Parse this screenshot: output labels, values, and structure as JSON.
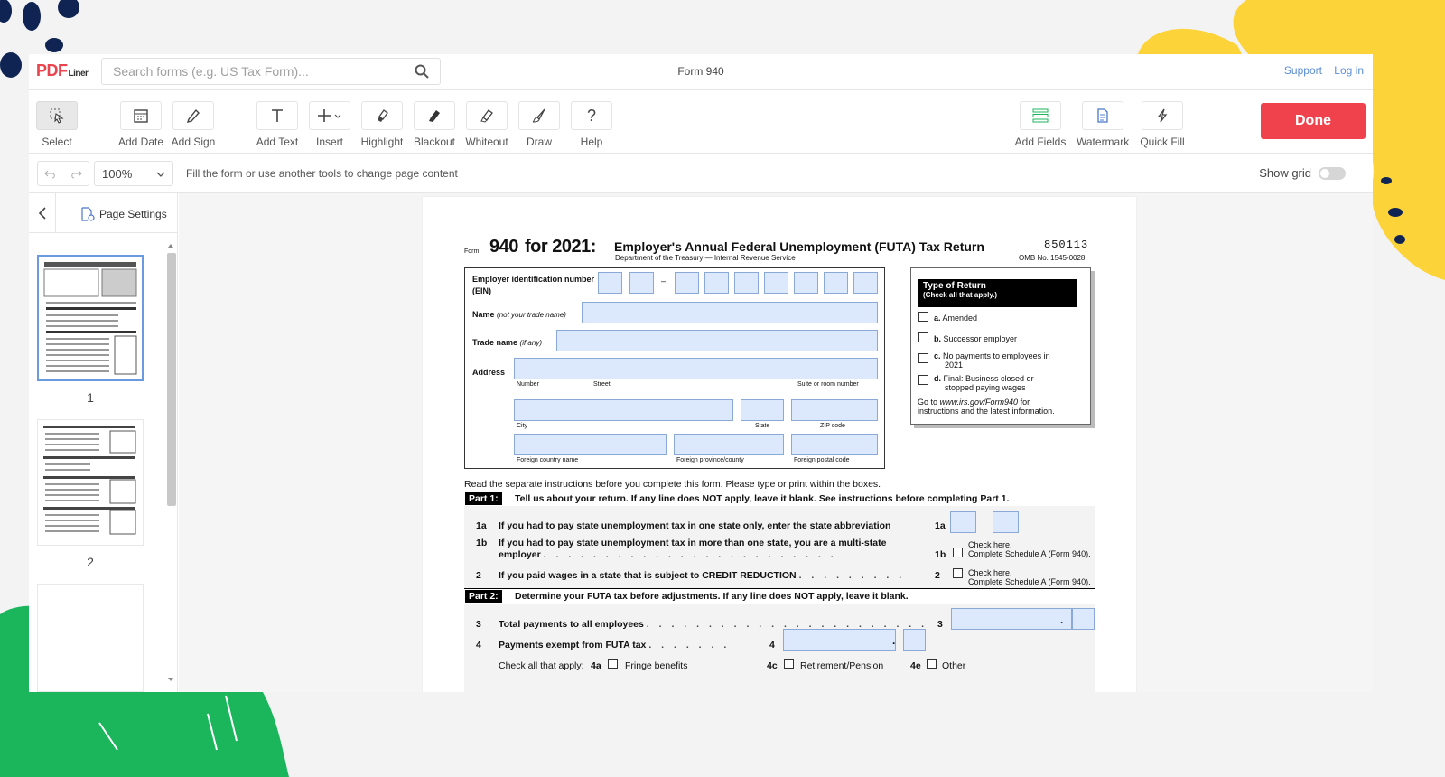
{
  "app": {
    "logo_main": "PDF",
    "logo_sub": "Liner",
    "search_placeholder": "Search forms (e.g. US Tax Form)...",
    "doc_title": "Form 940",
    "links": [
      "Support",
      "Log in"
    ]
  },
  "toolbar": {
    "tools": [
      {
        "name": "select",
        "label": "Select"
      },
      {
        "name": "add-date",
        "label": "Add Date"
      },
      {
        "name": "add-sign",
        "label": "Add Sign"
      },
      {
        "name": "add-text",
        "label": "Add Text"
      },
      {
        "name": "insert",
        "label": "Insert"
      },
      {
        "name": "highlight",
        "label": "Highlight"
      },
      {
        "name": "blackout",
        "label": "Blackout"
      },
      {
        "name": "whiteout",
        "label": "Whiteout"
      },
      {
        "name": "draw",
        "label": "Draw"
      },
      {
        "name": "help",
        "label": "Help"
      },
      {
        "name": "add-fields",
        "label": "Add Fields"
      },
      {
        "name": "watermark",
        "label": "Watermark"
      },
      {
        "name": "quick-fill",
        "label": "Quick Fill"
      }
    ],
    "done_label": "Done"
  },
  "options": {
    "zoom": "100%",
    "hint": "Fill the form or use another tools to change page content",
    "show_grid_label": "Show grid"
  },
  "sidebar": {
    "page_settings_label": "Page Settings",
    "pages": [
      "1",
      "2"
    ]
  },
  "form": {
    "form_word": "Form",
    "form_number": "940",
    "year": "for 2021:",
    "title": "Employer's Annual Federal Unemployment (FUTA) Tax Return",
    "dept": "Department of the Treasury — Internal Revenue Service",
    "code": "850113",
    "omb": "OMB No. 1545-0028",
    "ein_label": "Employer identification number",
    "ein_abbr": "(EIN)",
    "name_label": "Name",
    "name_note": "(not your trade name)",
    "trade_label": "Trade name",
    "trade_note": "(if any)",
    "address_label": "Address",
    "addr_number": "Number",
    "addr_street": "Street",
    "addr_suite": "Suite or room number",
    "addr_city": "City",
    "addr_state": "State",
    "addr_zip": "ZIP code",
    "addr_fcountry": "Foreign country name",
    "addr_fprov": "Foreign province/county",
    "addr_fpostal": "Foreign postal code",
    "type_title": "Type of Return",
    "type_sub": "(Check all that apply.)",
    "type_a": "Amended",
    "type_b": "Successor employer",
    "type_c1": "No payments to employees in",
    "type_c2": "2021",
    "type_d1": "Final: Business closed or",
    "type_d2": "stopped paying wages",
    "type_go1": "Go to",
    "type_go_url": "www.irs.gov/Form940",
    "type_go2": "for",
    "type_go3": "instructions and the latest information.",
    "instructions": "Read the separate instructions before you complete this form. Please type or print within the boxes.",
    "part1_label": "Part 1:",
    "part1_text": "Tell us about your return. If any line does NOT apply, leave it blank. See instructions before completing Part 1.",
    "line1a_num": "1a",
    "line1a_text": "If you had to pay state unemployment tax in one state only, enter the state abbreviation",
    "line1b_num": "1b",
    "line1b_text1": "If you had to pay state unemployment tax in more than one state, you are a multi-state",
    "line1b_text2": "employer",
    "check_here": "Check here.",
    "complete_sched": "Complete Schedule A (Form 940).",
    "line2_num": "2",
    "line2_text": "If you paid wages in a state that is subject to CREDIT REDUCTION",
    "part2_label": "Part 2:",
    "part2_text": "Determine your FUTA tax before adjustments. If any line does NOT apply, leave it blank.",
    "line3_num": "3",
    "line3_text": "Total payments to all employees",
    "line4_num": "4",
    "line4_text": "Payments exempt from FUTA tax",
    "check_all": "Check all that apply:",
    "l4a": "4a",
    "l4a_text": "Fringe benefits",
    "l4c": "4c",
    "l4c_text": "Retirement/Pension",
    "l4e": "4e",
    "l4e_text": "Other"
  },
  "colors": {
    "accent": "#f0424c",
    "link": "#5b8ed6",
    "field_fill": "#dce8fb",
    "deco_yellow": "#fdd33a",
    "deco_green": "#1bb55c",
    "deco_navy": "#0f2452"
  }
}
